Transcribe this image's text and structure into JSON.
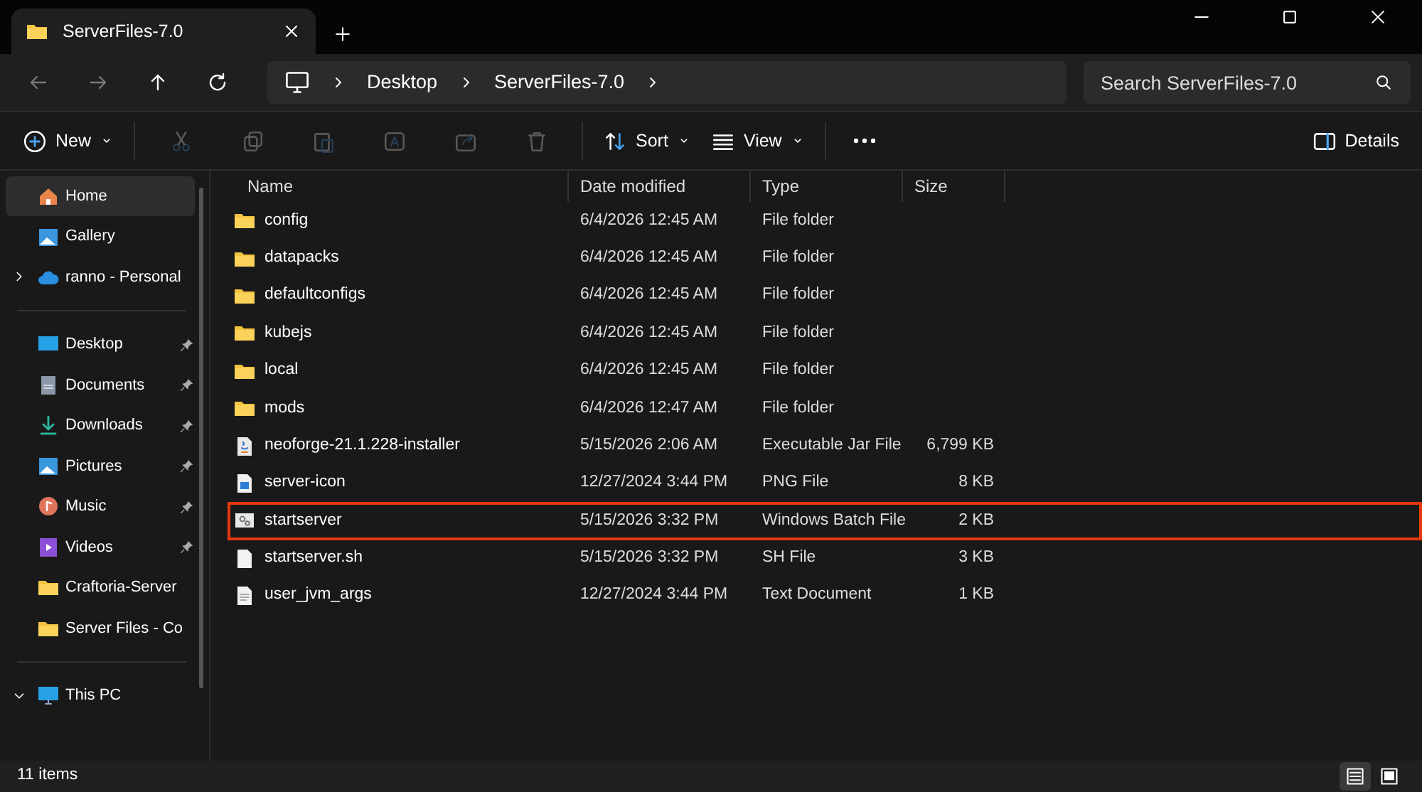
{
  "window": {
    "tab_title": "ServerFiles-7.0"
  },
  "nav_buttons": [
    {
      "kind": "back",
      "disabled": true
    },
    {
      "kind": "forward",
      "disabled": true
    },
    {
      "kind": "up",
      "disabled": false
    },
    {
      "kind": "refresh",
      "disabled": false
    }
  ],
  "breadcrumb": [
    "Desktop",
    "ServerFiles-7.0"
  ],
  "search": {
    "placeholder": "Search ServerFiles-7.0"
  },
  "toolbar": [
    {
      "kind": "new",
      "label": "New",
      "disabled": false
    },
    {
      "kind": "cut",
      "disabled": true
    },
    {
      "kind": "copy",
      "disabled": true
    },
    {
      "kind": "paste",
      "disabled": true
    },
    {
      "kind": "rename",
      "disabled": true
    },
    {
      "kind": "share",
      "disabled": true
    },
    {
      "kind": "delete",
      "disabled": true
    },
    {
      "kind": "sort",
      "label": "Sort",
      "disabled": false
    },
    {
      "kind": "view",
      "label": "View",
      "disabled": false
    },
    {
      "kind": "more",
      "disabled": false
    }
  ],
  "details_button": {
    "label": "Details"
  },
  "sidebar": {
    "groups": [
      [
        {
          "label": "Home",
          "kind": "home",
          "selected": true,
          "pinned": false
        },
        {
          "label": "Gallery",
          "kind": "gallery",
          "selected": false,
          "pinned": false
        },
        {
          "label": "ranno - Personal",
          "kind": "cloud",
          "selected": false,
          "pinned": false,
          "expanded": false
        }
      ],
      [
        {
          "label": "Desktop",
          "kind": "desktop",
          "selected": false,
          "pinned": true
        },
        {
          "label": "Documents",
          "kind": "documents",
          "selected": false,
          "pinned": true
        },
        {
          "label": "Downloads",
          "kind": "downloads",
          "selected": false,
          "pinned": true
        },
        {
          "label": "Pictures",
          "kind": "pictures",
          "selected": false,
          "pinned": true
        },
        {
          "label": "Music",
          "kind": "music",
          "selected": false,
          "pinned": true
        },
        {
          "label": "Videos",
          "kind": "videos",
          "selected": false,
          "pinned": true
        },
        {
          "label": "Craftoria-Server",
          "kind": "folder",
          "selected": false,
          "pinned": false
        },
        {
          "label": "Server Files - Co",
          "kind": "folder",
          "selected": false,
          "pinned": false
        }
      ],
      [
        {
          "label": "This PC",
          "kind": "pc",
          "selected": false,
          "pinned": false,
          "expanded": true
        }
      ]
    ]
  },
  "table": {
    "columns": [
      "Name",
      "Date modified",
      "Type",
      "Size"
    ],
    "rows": [
      {
        "name": "config",
        "date": "6/4/2026 12:45 AM",
        "type": "File folder",
        "kind": "folder",
        "highlighted": false
      },
      {
        "name": "datapacks",
        "date": "6/4/2026 12:45 AM",
        "type": "File folder",
        "kind": "folder",
        "highlighted": false
      },
      {
        "name": "defaultconfigs",
        "date": "6/4/2026 12:45 AM",
        "type": "File folder",
        "kind": "folder",
        "highlighted": false
      },
      {
        "name": "kubejs",
        "date": "6/4/2026 12:45 AM",
        "type": "File folder",
        "kind": "folder",
        "highlighted": false
      },
      {
        "name": "local",
        "date": "6/4/2026 12:45 AM",
        "type": "File folder",
        "kind": "folder",
        "highlighted": false
      },
      {
        "name": "mods",
        "date": "6/4/2026 12:47 AM",
        "type": "File folder",
        "kind": "folder",
        "highlighted": false
      },
      {
        "name": "neoforge-21.1.228-installer",
        "date": "5/15/2026 2:06 AM",
        "type": "Executable Jar File",
        "size": "6,799 KB",
        "kind": "jar",
        "highlighted": false
      },
      {
        "name": "server-icon",
        "date": "12/27/2024 3:44 PM",
        "type": "PNG File",
        "size": "8 KB",
        "kind": "image",
        "highlighted": false
      },
      {
        "name": "startserver",
        "date": "5/15/2026 3:32 PM",
        "type": "Windows Batch File",
        "size": "2 KB",
        "kind": "batch",
        "highlighted": true
      },
      {
        "name": "startserver.sh",
        "date": "5/15/2026 3:32 PM",
        "type": "SH File",
        "size": "3 KB",
        "kind": "file",
        "highlighted": false
      },
      {
        "name": "user_jvm_args",
        "date": "12/27/2024 3:44 PM",
        "type": "Text Document",
        "size": "1 KB",
        "kind": "text",
        "highlighted": false
      }
    ]
  },
  "status_bar": {
    "count": "11 items"
  },
  "view_modes": [
    {
      "kind": "details",
      "selected": true
    },
    {
      "kind": "tiles",
      "selected": false
    }
  ]
}
